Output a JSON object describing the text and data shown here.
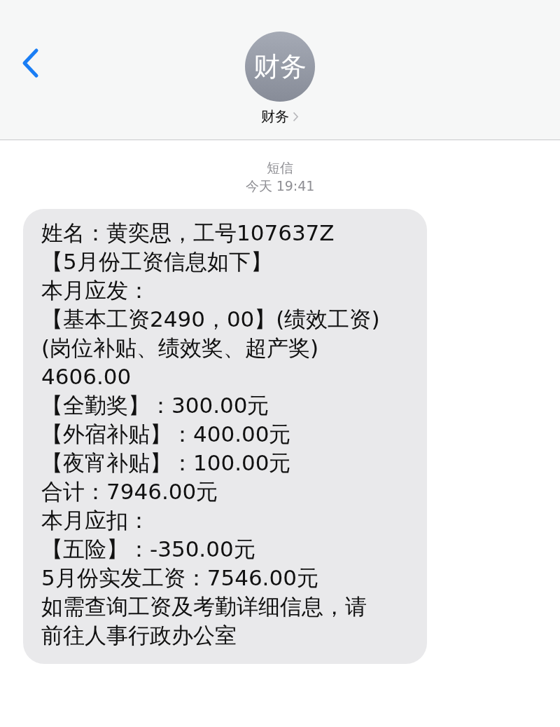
{
  "header": {
    "avatar_text": "财务",
    "contact_name": "财务"
  },
  "conversation": {
    "service": "短信",
    "timestamp": "今天 19:41"
  },
  "message": {
    "lines": [
      "姓名：黄奕思，工号107637Z",
      "【5月份工资信息如下】",
      "本月应发：",
      "【基本工资2490，00】(绩效工资)",
      "(岗位补贴、绩效奖、超产奖)",
      "4606.00",
      "【全勤奖】：300.00元",
      "【外宿补贴】：400.00元",
      "【夜宵补贴】：100.00元",
      "合计：7946.00元",
      "本月应扣：",
      "【五险】：-350.00元",
      "5月份实发工资：7546.00元",
      "如需查询工资及考勤详细信息，请",
      "前往人事行政办公室"
    ]
  }
}
